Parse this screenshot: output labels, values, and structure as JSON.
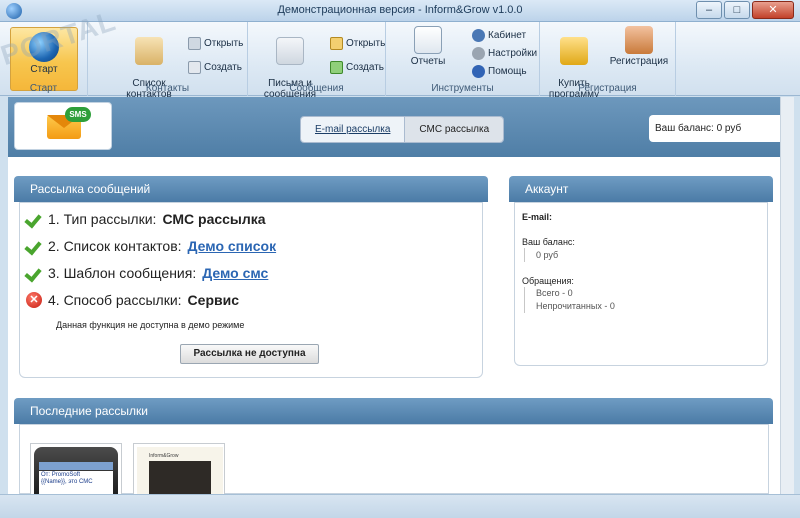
{
  "window": {
    "title": "Демонстрационная версия - Inform&Grow v1.0.0",
    "controls": {
      "minimize": "–",
      "maximize": "□",
      "close": "✕"
    }
  },
  "watermark": "PORTAL",
  "ribbon": {
    "start": {
      "label": "Старт",
      "group_label": "Старт",
      "icon": "globe-icon"
    },
    "contacts": {
      "group_label": "Контакты",
      "list_label": "Список\nконтактов",
      "open_label": "Открыть",
      "create_label": "Создать"
    },
    "messages": {
      "group_label": "Сообщения",
      "letters_label": "Письма и\nсообщения",
      "open_label": "Открыть",
      "create_label": "Создать"
    },
    "tools": {
      "group_label": "Инструменты",
      "reports_label": "Отчеты",
      "cabinet_label": "Кабинет",
      "settings_label": "Настройки",
      "help_label": "Помощь"
    },
    "registration": {
      "group_label": "Регистрация",
      "buy_label": "Купить\nпрограмму",
      "register_label": "Регистрация"
    }
  },
  "toolbar": {
    "sms_badge": "SMS",
    "tabs": [
      {
        "label": "E-mail рассылка",
        "active": false
      },
      {
        "label": "СМС рассылка",
        "active": true
      }
    ],
    "balance_text": "Ваш баланс: 0 руб"
  },
  "mailing": {
    "header": "Рассылка сообщений",
    "steps": [
      {
        "prefix": "1. Тип рассылки:",
        "value": "СМС рассылка",
        "status": "ok",
        "link": false
      },
      {
        "prefix": "2. Список контактов:",
        "value": "Демо список",
        "status": "ok",
        "link": true
      },
      {
        "prefix": "3. Шаблон сообщения:",
        "value": "Демо смс",
        "status": "ok",
        "link": true
      },
      {
        "prefix": "4. Способ рассылки:",
        "value": "Сервис",
        "status": "error",
        "link": false
      }
    ],
    "note": "Данная функция не доступна в демо режиме",
    "button_label": "Рассылка не доступна"
  },
  "account": {
    "header": "Аккаунт",
    "email_label": "E-mail:",
    "balance_label": "Ваш баланс:",
    "balance_value": "0 руб",
    "requests_label": "Обращения:",
    "total_text": "Всего - 0",
    "unread_text": "Непрочитанных - 0"
  },
  "recent": {
    "header": "Последние рассылки",
    "thumb1_text": "От: PromoSoft\n{{Name}}, это СМС",
    "thumb2_title": "Inform&Grow"
  },
  "colors": {
    "panel_header": "#4b7ba6",
    "start_button": "#f7c64e",
    "link": "#2b66b3",
    "ok_check": "#4aa52e",
    "error": "#c51b10"
  }
}
